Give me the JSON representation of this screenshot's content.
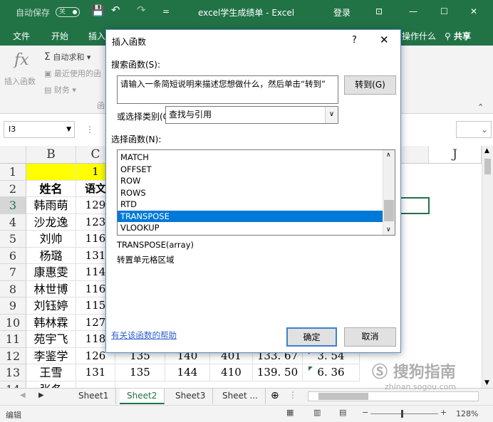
{
  "titlebar": {
    "autosave_label": "自动保存",
    "autosave_state": "关",
    "doc_title": "excel学生成绩单  -  Excel",
    "login": "登录",
    "bg_color": "#217346"
  },
  "ribbon_tabs": [
    "文件",
    "开始",
    "插入",
    "操作什么",
    "共享"
  ],
  "ribbon": {
    "insert_function": "插入函数",
    "fx_symbol": "fx",
    "autosum": "自动求和",
    "recent": "最近使用的函",
    "finance": "财务",
    "group_label": "函"
  },
  "formula_bar": {
    "name_box": "I3"
  },
  "sheet": {
    "columns": [
      "B",
      "C",
      "J"
    ],
    "rows": [
      "1",
      "2",
      "3",
      "4",
      "5",
      "6",
      "7",
      "8",
      "9",
      "10",
      "11",
      "12",
      "13",
      "14"
    ],
    "header_cells": {
      "B2": "姓名",
      "C2": "语文",
      "C1": "1"
    },
    "names": [
      "韩雨萌",
      "沙龙逸",
      "刘帅",
      "杨璐",
      "康惠雯",
      "林世博",
      "刘钰婷",
      "韩林霖",
      "苑宇飞",
      "李鉴学",
      "王雪",
      "张冬"
    ],
    "c_values": [
      "129",
      "123",
      "116",
      "131",
      "114",
      "116",
      "115",
      "127",
      "118",
      "126",
      "131",
      ""
    ],
    "row12_rest": [
      "135",
      "140",
      "401",
      "133. 67",
      "3. 54"
    ],
    "row13_rest": [
      "135",
      "144",
      "410",
      "139. 50",
      "6. 36"
    ]
  },
  "sheet_tabs": [
    "Sheet1",
    "Sheet2",
    "Sheet3",
    "Sheet ..."
  ],
  "active_sheet": "Sheet2",
  "status": {
    "mode": "编辑",
    "zoom": "128%"
  },
  "watermark": "搜狗指南",
  "watermark_url": "zhinan.sogou.com",
  "dialog": {
    "title": "插入函数",
    "help": "?",
    "close": "✕",
    "search_label": "搜索函数(S):",
    "search_placeholder": "请输入一条简短说明来描述您想做什么，然后单击“转到”",
    "go_button": "转到(G)",
    "category_label": "或选择类别(C):",
    "category_value": "查找与引用",
    "select_label": "选择函数(N):",
    "functions": [
      "MATCH",
      "OFFSET",
      "ROW",
      "ROWS",
      "RTD",
      "TRANSPOSE",
      "VLOOKUP"
    ],
    "selected_function": "TRANSPOSE",
    "signature": "TRANSPOSE(array)",
    "description": "转置单元格区域",
    "help_link": "有关该函数的帮助",
    "ok": "确定",
    "cancel": "取消"
  }
}
